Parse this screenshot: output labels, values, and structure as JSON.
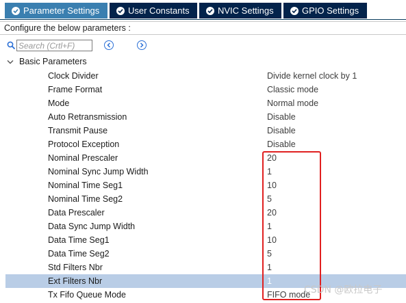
{
  "tabs": [
    {
      "label": "Parameter Settings",
      "active": true
    },
    {
      "label": "User Constants",
      "active": false
    },
    {
      "label": "NVIC Settings",
      "active": false
    },
    {
      "label": "GPIO Settings",
      "active": false
    }
  ],
  "config_instruction": "Configure the below parameters :",
  "search": {
    "placeholder": "Search (Crtl+F)",
    "value": ""
  },
  "group": {
    "label": "Basic Parameters"
  },
  "parameters": [
    {
      "name": "Clock Divider",
      "value": "Divide kernel clock by 1"
    },
    {
      "name": "Frame Format",
      "value": "Classic mode"
    },
    {
      "name": "Mode",
      "value": "Normal mode"
    },
    {
      "name": "Auto Retransmission",
      "value": "Disable"
    },
    {
      "name": "Transmit Pause",
      "value": "Disable"
    },
    {
      "name": "Protocol Exception",
      "value": "Disable"
    },
    {
      "name": "Nominal Prescaler",
      "value": "20"
    },
    {
      "name": "Nominal Sync Jump Width",
      "value": "1"
    },
    {
      "name": "Nominal Time Seg1",
      "value": "10"
    },
    {
      "name": "Nominal Time Seg2",
      "value": "5"
    },
    {
      "name": "Data Prescaler",
      "value": "20"
    },
    {
      "name": "Data Sync Jump Width",
      "value": "1"
    },
    {
      "name": "Data Time Seg1",
      "value": "10"
    },
    {
      "name": "Data Time Seg2",
      "value": "5"
    },
    {
      "name": "Std Filters Nbr",
      "value": "1"
    },
    {
      "name": "Ext Filters Nbr",
      "value": "1",
      "selected": true
    },
    {
      "name": "Tx Fifo Queue Mode",
      "value": "FIFO mode"
    }
  ],
  "watermark": "CSDN @欧拉电子",
  "colors": {
    "tab_active": "#3a7fb0",
    "tab_inactive": "#03234b",
    "selected_row": "#b9cde6",
    "highlight_box": "#e02020"
  }
}
